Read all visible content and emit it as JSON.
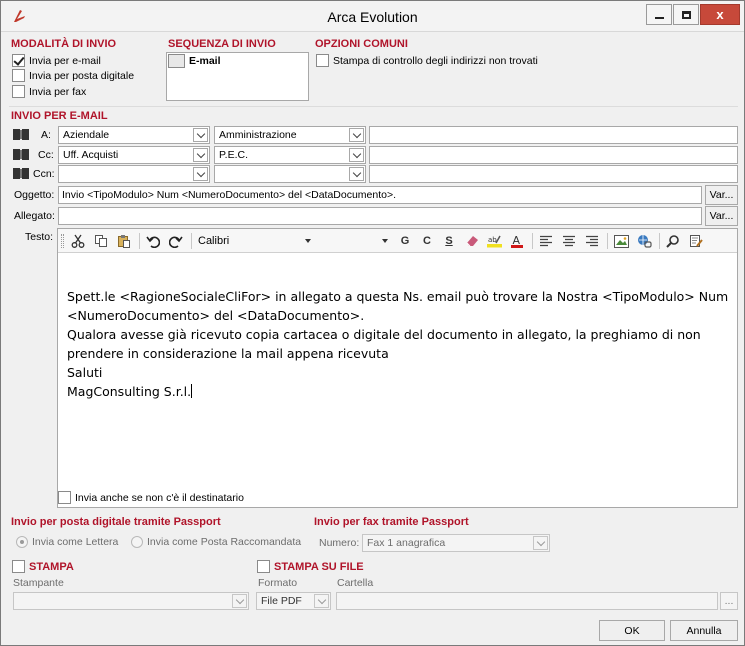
{
  "window": {
    "title": "Arca Evolution",
    "min_label": "–",
    "max_label": "☐",
    "close_label": "x"
  },
  "modalita": {
    "title": "MODALITÀ DI INVIO",
    "options": [
      {
        "label": "Invia per e-mail",
        "checked": true
      },
      {
        "label": "Invia per posta digitale",
        "checked": false
      },
      {
        "label": "Invia per fax",
        "checked": false
      }
    ]
  },
  "sequenza": {
    "title": "SEQUENZA DI INVIO",
    "items": [
      "E-mail"
    ]
  },
  "opzioni": {
    "title": "OPZIONI COMUNI",
    "stampa_controllo": "Stampa di controllo degli indirizzi non trovati"
  },
  "email": {
    "title": "INVIO PER E-MAIL",
    "a": {
      "label": "A:",
      "combo1": "Aziendale",
      "combo2": "Amministrazione",
      "value": ""
    },
    "cc": {
      "label": "Cc:",
      "combo1": "Uff. Acquisti",
      "combo2": "P.E.C.",
      "value": ""
    },
    "ccn": {
      "label": "Ccn:",
      "combo1": "",
      "combo2": "",
      "value": ""
    },
    "oggetto": {
      "label": "Oggetto:",
      "value": "Invio <TipoModulo> Num <NumeroDocumento> del  <DataDocumento>.",
      "button": "Var..."
    },
    "allegato": {
      "label": "Allegato:",
      "value": "",
      "button": "Var..."
    },
    "testo": {
      "label": "Testo:"
    }
  },
  "toolbar": {
    "font": "Calibri",
    "size": "",
    "bold": "G",
    "italic": "C",
    "underline": "S"
  },
  "body_lines": [
    "Spett.le  <RagioneSocialeCliFor> in allegato a questa Ns. email  può trovare la Nostra <TipoModulo> Num",
    "<NumeroDocumento> del <DataDocumento>.",
    "Qualora avesse già ricevuto copia cartacea o digitale del documento in allegato, la preghiamo di non",
    "prendere in considerazione la mail appena ricevuta",
    "Saluti",
    "MagConsulting S.r.l."
  ],
  "invia_anche": "Invia anche se non c'è il destinatario",
  "posta_digitale": {
    "title": "Invio per posta digitale tramite Passport",
    "options": [
      "Invia come Lettera",
      "Invia come Posta Raccomandata"
    ]
  },
  "fax": {
    "title": "Invio per fax tramite Passport",
    "numero_label": "Numero:",
    "numero_value": "Fax 1 anagrafica"
  },
  "stampa": {
    "title": "STAMPA",
    "stampante_label": "Stampante",
    "stampante_value": ""
  },
  "stampa_file": {
    "title": "STAMPA SU FILE",
    "formato_label": "Formato",
    "formato_value": "File PDF",
    "cartella_label": "Cartella",
    "cartella_value": "",
    "browse": "..."
  },
  "buttons": {
    "ok": "OK",
    "annulla": "Annulla"
  },
  "colors": {
    "section_red": "#b0142a",
    "close_button": "#c7493a"
  }
}
